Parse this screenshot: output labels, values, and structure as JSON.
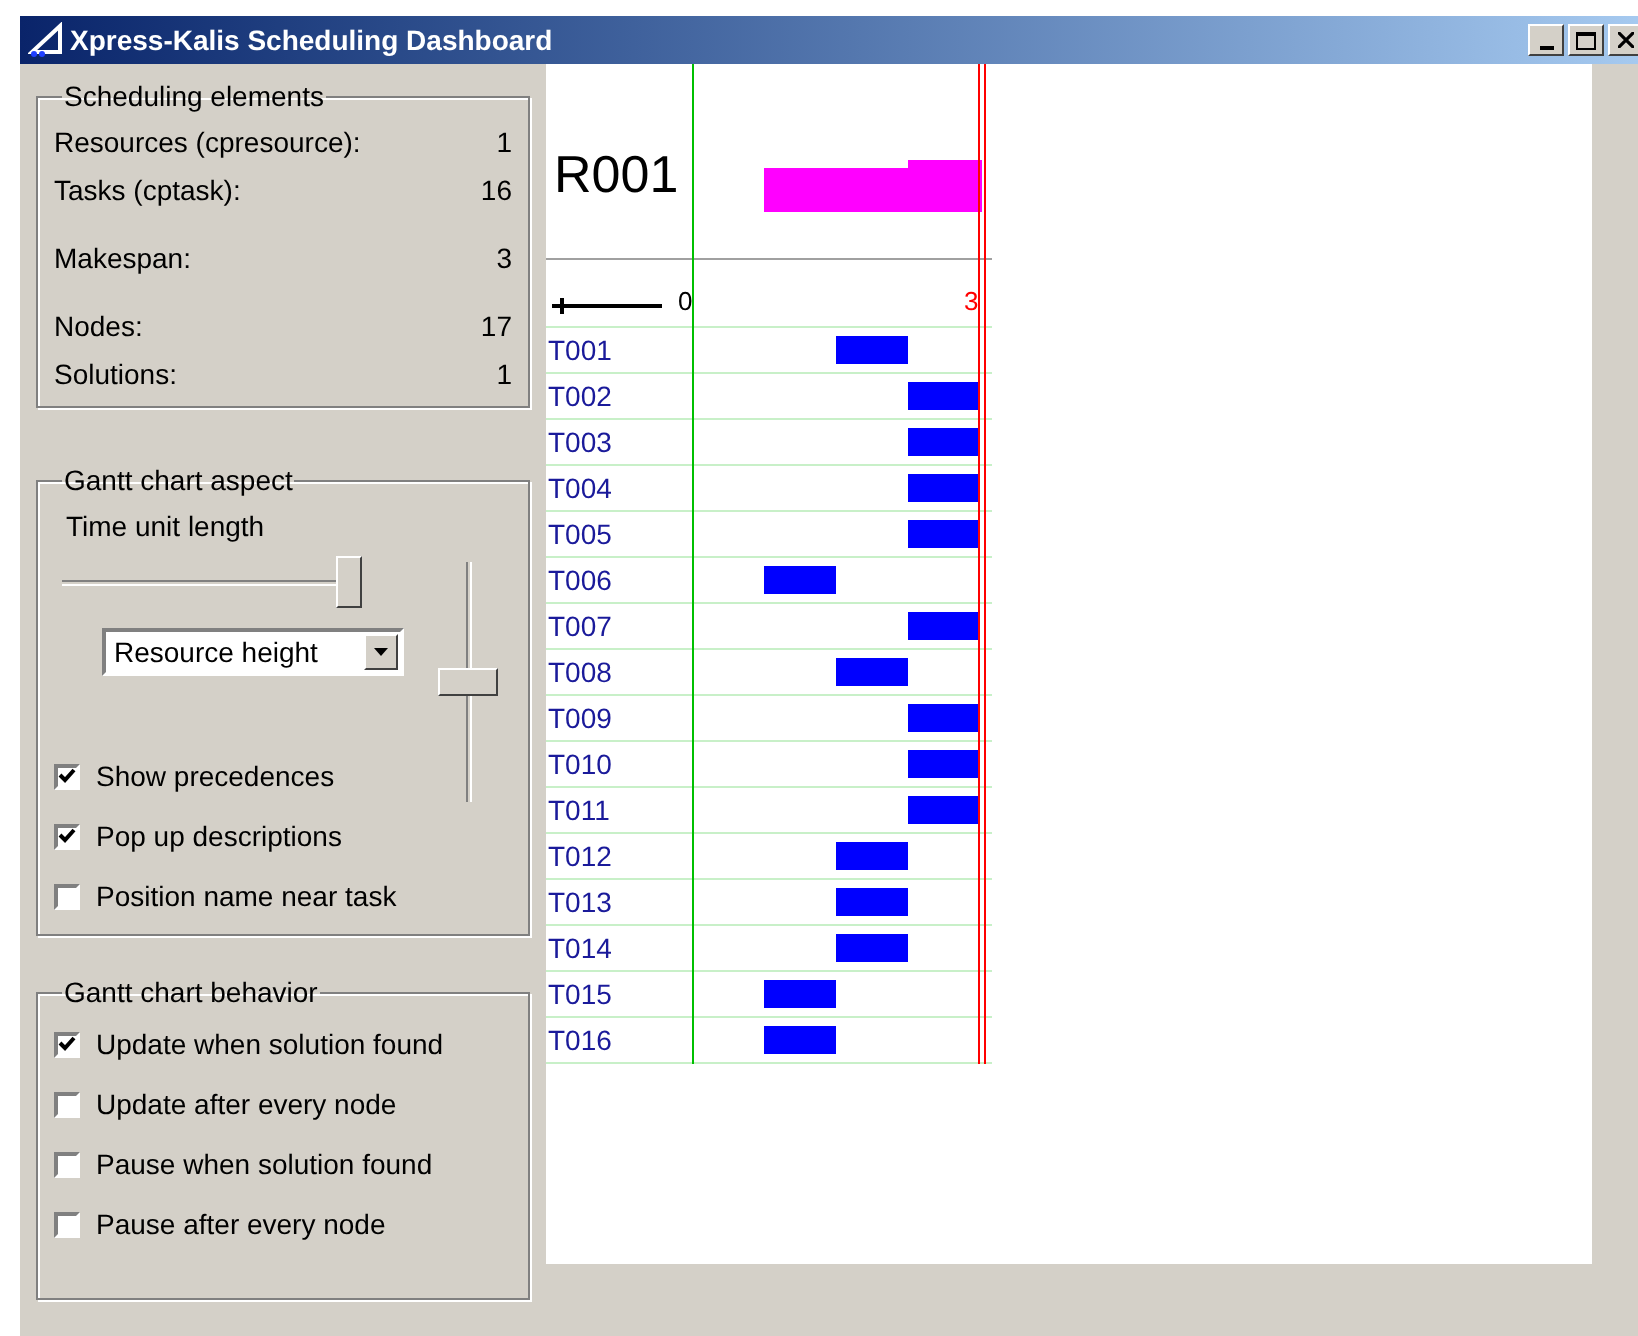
{
  "window": {
    "title": "Xpress-Kalis Scheduling Dashboard"
  },
  "scheduling_elements": {
    "title": "Scheduling elements",
    "stats": [
      {
        "label": "Resources (cpresource):",
        "value": "1"
      },
      {
        "label": "Tasks (cptask):",
        "value": "16"
      },
      {
        "label": "Makespan:",
        "value": "3"
      },
      {
        "label": "Nodes:",
        "value": "17"
      },
      {
        "label": "Solutions:",
        "value": "1"
      }
    ]
  },
  "gantt_aspect": {
    "title": "Gantt chart aspect",
    "time_unit_label": "Time unit length",
    "time_unit_slider": {
      "level": 1
    },
    "height_dropdown": {
      "value": "Resource height"
    },
    "height_slider": {
      "level": 0.5
    },
    "options": [
      {
        "label": "Show precedences",
        "checked": true
      },
      {
        "label": "Pop up descriptions",
        "checked": true
      },
      {
        "label": "Position name near task",
        "checked": false
      }
    ]
  },
  "gantt_behavior": {
    "title": "Gantt chart behavior",
    "options": [
      {
        "label": "Update when solution found",
        "checked": true
      },
      {
        "label": "Update after every node",
        "checked": false
      },
      {
        "label": "Pause when solution found",
        "checked": false
      },
      {
        "label": "Pause after every node",
        "checked": false
      }
    ]
  },
  "gantt": {
    "resource": "R001",
    "axis_start": "0",
    "axis_end": "3",
    "tasks": [
      {
        "name": "T001",
        "kind": "second"
      },
      {
        "name": "T002",
        "kind": "third"
      },
      {
        "name": "T003",
        "kind": "third"
      },
      {
        "name": "T004",
        "kind": "third"
      },
      {
        "name": "T005",
        "kind": "third"
      },
      {
        "name": "T006",
        "kind": "first"
      },
      {
        "name": "T007",
        "kind": "third"
      },
      {
        "name": "T008",
        "kind": "second"
      },
      {
        "name": "T009",
        "kind": "third"
      },
      {
        "name": "T010",
        "kind": "third"
      },
      {
        "name": "T011",
        "kind": "third"
      },
      {
        "name": "T012",
        "kind": "second"
      },
      {
        "name": "T013",
        "kind": "second"
      },
      {
        "name": "T014",
        "kind": "second"
      },
      {
        "name": "T015",
        "kind": "first"
      },
      {
        "name": "T016",
        "kind": "first"
      }
    ]
  }
}
